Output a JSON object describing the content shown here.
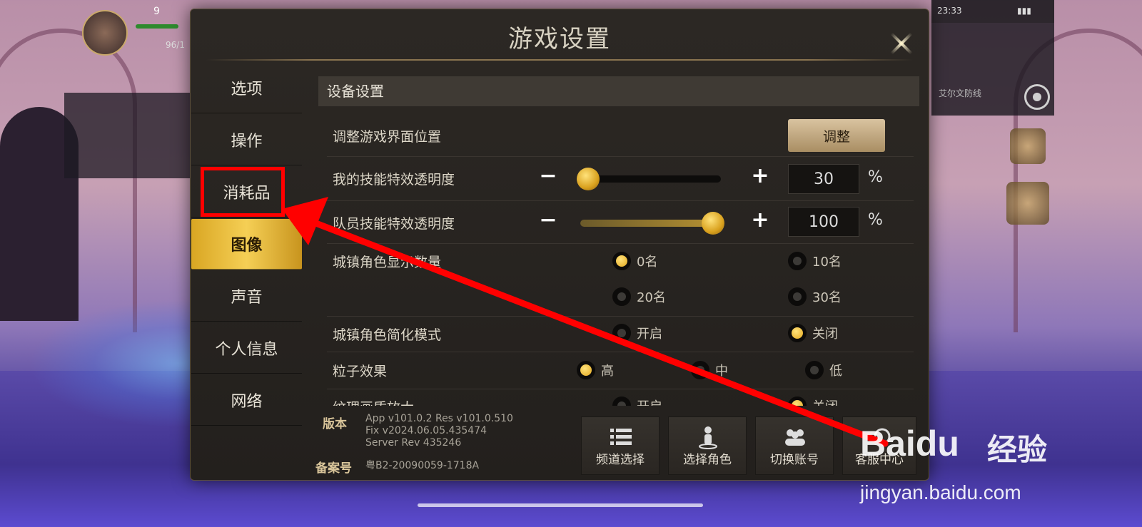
{
  "hud": {
    "level": "9",
    "mini": "96/1"
  },
  "status_bar": {
    "time": "23:33"
  },
  "side_panel": {
    "player_name": "艾尔文防线"
  },
  "dialog": {
    "title": "游戏设置",
    "nav": [
      {
        "label": "选项",
        "active": false
      },
      {
        "label": "操作",
        "active": false
      },
      {
        "label": "消耗品",
        "active": false,
        "highlighted": true
      },
      {
        "label": "图像",
        "active": true
      },
      {
        "label": "声音",
        "active": false
      },
      {
        "label": "个人信息",
        "active": false
      },
      {
        "label": "网络",
        "active": false
      }
    ],
    "section_title": "设备设置",
    "ui_position": {
      "label": "调整游戏界面位置",
      "button": "调整"
    },
    "my_skill_alpha": {
      "label": "我的技能特效透明度",
      "value": "30",
      "unit": "%",
      "level": 0.0
    },
    "party_skill_alpha": {
      "label": "队员技能特效透明度",
      "value": "100",
      "unit": "%",
      "level": 1.0
    },
    "town_char_count": {
      "label": "城镇角色显示数量",
      "options": [
        {
          "label": "0名",
          "selected": true
        },
        {
          "label": "10名",
          "selected": false
        },
        {
          "label": "20名",
          "selected": false
        },
        {
          "label": "30名",
          "selected": false
        }
      ]
    },
    "town_simple_mode": {
      "label": "城镇角色简化模式",
      "options": [
        {
          "label": "开启",
          "selected": false
        },
        {
          "label": "关闭",
          "selected": true
        }
      ]
    },
    "particle_effect": {
      "label": "粒子效果",
      "options": [
        {
          "label": "高",
          "selected": true
        },
        {
          "label": "中",
          "selected": false
        },
        {
          "label": "低",
          "selected": false
        }
      ]
    },
    "texture_upscale": {
      "label": "纹理画质放大",
      "options": [
        {
          "label": "开启",
          "selected": false
        },
        {
          "label": "关闭",
          "selected": true
        }
      ]
    }
  },
  "footer": {
    "version_label": "版本",
    "version_lines": [
      "App v101.0.2 Res v101.0.510",
      "Fix v2024.06.05.435474",
      "Server Rev 435246"
    ],
    "icp_label": "备案号",
    "icp_value": "粤B2-20090059-1718A",
    "buttons": [
      "频道选择",
      "选择角色",
      "切换账号",
      "客服中心"
    ]
  },
  "watermark": {
    "brand": "Baidu",
    "cn": "经验",
    "url": "jingyan.baidu.com"
  },
  "colors": {
    "accent": "#f5cf55",
    "annotation": "#ff0000",
    "panel": "#2c2824"
  }
}
